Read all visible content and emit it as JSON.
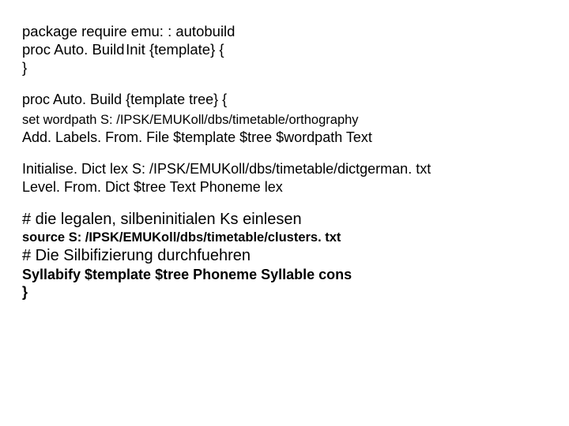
{
  "lines": {
    "l1": "package require emu: : autobuild",
    "l2": "proc Auto. Build Init {template} {",
    "l3": "}",
    "l4": "proc Auto. Build {template tree} {",
    "l5": "set wordpath S: /IPSK/EMUKoll/dbs/timetable/orthography",
    "l6": "Add. Labels. From. File $template $tree $wordpath Text",
    "l7": "Initialise. Dict lex S: /IPSK/EMUKoll/dbs/timetable/dictgerman. txt",
    "l8": "Level. From. Dict $tree Text Phoneme lex",
    "l9": "# die legalen, silbeninitialen Ks einlesen",
    "l10": "source S: /IPSK/EMUKoll/dbs/timetable/clusters. txt",
    "l11": "# Die Silbifizierung durchfuehren",
    "l12": "Syllabify $template $tree Phoneme Syllable cons",
    "l13": "}"
  }
}
